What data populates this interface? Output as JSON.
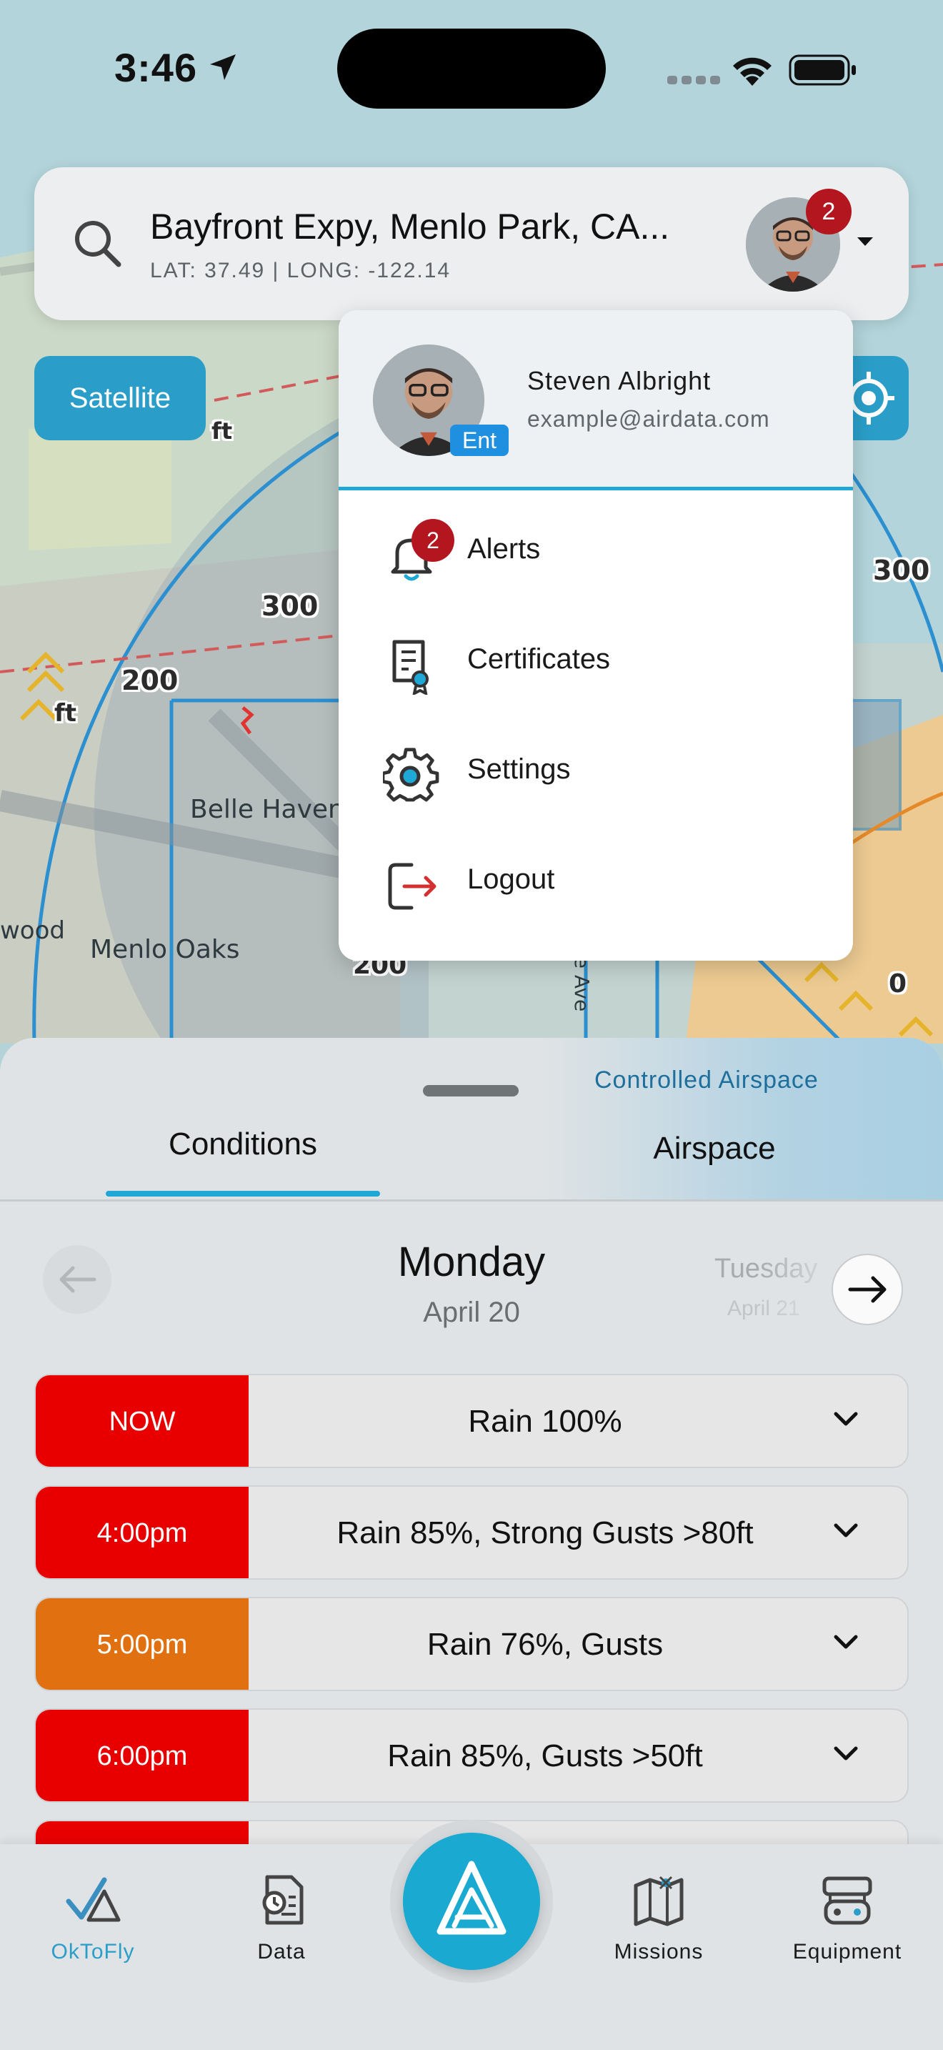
{
  "status_bar": {
    "time": "3:46"
  },
  "search": {
    "address": "Bayfront Expy, Menlo Park, CA...",
    "coords": "LAT: 37.49 | LONG: -122.14",
    "alerts_count": "2"
  },
  "map": {
    "satellite_label": "Satellite",
    "labels": [
      "Belle Haven",
      "Menlo Oaks",
      "wood"
    ],
    "altitudes": [
      "300",
      "200",
      "300",
      "200",
      "0"
    ],
    "feet_labels": [
      "ft",
      "ft"
    ],
    "street": "e Ave"
  },
  "user_menu": {
    "name": "Steven Albright",
    "email": "example@airdata.com",
    "plan_badge": "Ent",
    "items": [
      {
        "label": "Alerts",
        "icon": "bell-icon",
        "badge": "2"
      },
      {
        "label": "Certificates",
        "icon": "certificate-icon"
      },
      {
        "label": "Settings",
        "icon": "gear-icon"
      },
      {
        "label": "Logout",
        "icon": "logout-icon"
      }
    ]
  },
  "sheet": {
    "airspace_status": "Controlled Airspace",
    "tabs": [
      {
        "label": "Conditions",
        "active": true
      },
      {
        "label": "Airspace",
        "active": false
      }
    ],
    "day_name": "Monday",
    "day_date": "April 20",
    "next_day": "Tuesday",
    "next_day_date": "April 21",
    "conditions": [
      {
        "time": "NOW",
        "summary": "Rain 100%",
        "color": "#e80000"
      },
      {
        "time": "4:00pm",
        "summary": "Rain 85%, Strong Gusts >80ft",
        "color": "#e80000"
      },
      {
        "time": "5:00pm",
        "summary": "Rain 76%, Gusts",
        "color": "#e07010"
      },
      {
        "time": "6:00pm",
        "summary": "Rain 85%, Gusts >50ft",
        "color": "#e80000"
      }
    ]
  },
  "bottom_nav": {
    "items": [
      {
        "label": "OkToFly",
        "icon": "oktofly-icon",
        "active": true
      },
      {
        "label": "Data",
        "icon": "data-icon",
        "active": false
      },
      {
        "label": "Missions",
        "icon": "missions-icon",
        "active": false
      },
      {
        "label": "Equipment",
        "icon": "equipment-icon",
        "active": false
      }
    ]
  },
  "colors": {
    "accent": "#1fa7d6",
    "badge": "#b3161f",
    "danger": "#e80000",
    "warning": "#e07010"
  }
}
